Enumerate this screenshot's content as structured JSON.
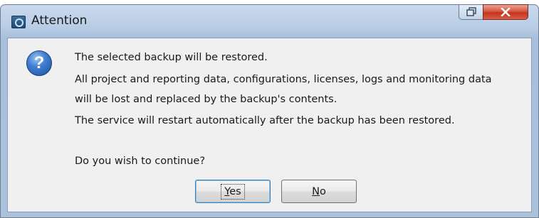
{
  "window": {
    "title": "Attention"
  },
  "titlebar_buttons": {
    "restore_icon": "restore-icon",
    "close_icon": "close-icon"
  },
  "message": {
    "icon": "question-icon",
    "icon_glyph": "?",
    "line1": "The selected backup will be restored.",
    "line2": "All project and reporting data, configurations, licenses, logs and monitoring data",
    "line3": "will be lost and replaced by the backup's contents.",
    "line4": "The service will restart automatically after the backup has been restored.",
    "question": "Do you wish to continue?"
  },
  "buttons": {
    "yes_accel": "Y",
    "yes_rest": "es",
    "no_accel": "N",
    "no_rest": "o"
  },
  "colors": {
    "close_button": "#c4321c",
    "icon_blue": "#3f7fd0",
    "frame": "#b9cde6"
  }
}
